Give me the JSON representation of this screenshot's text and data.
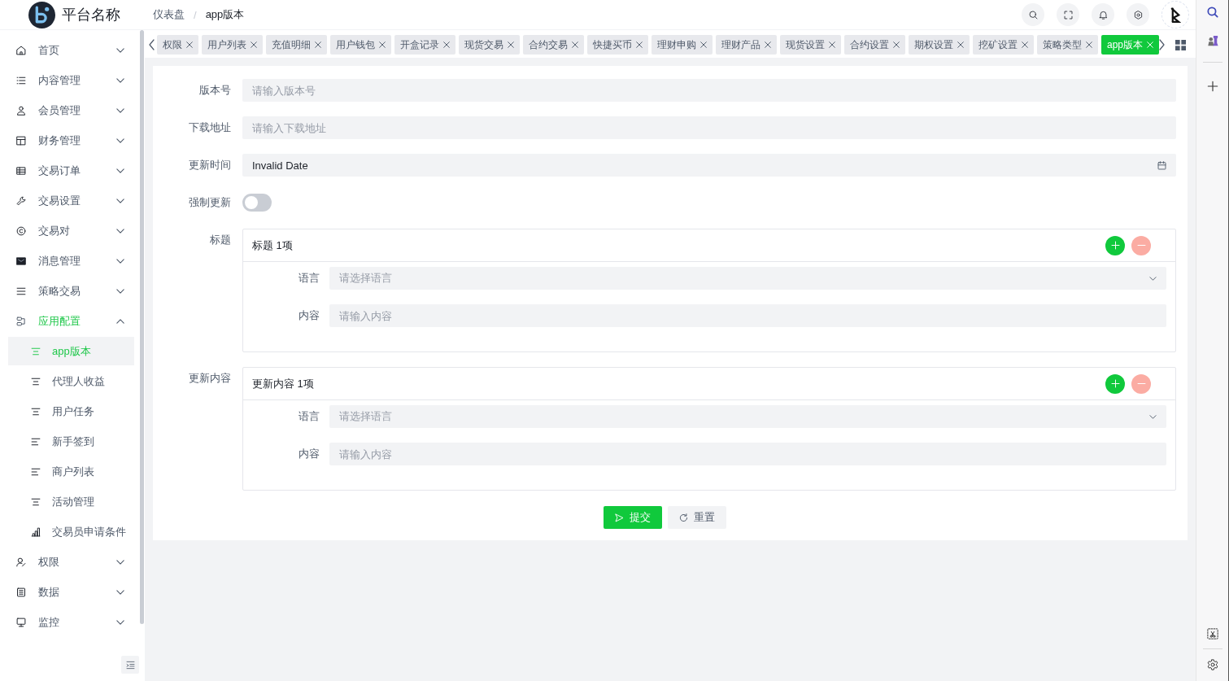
{
  "header": {
    "brand": "平台名称",
    "breadcrumb": {
      "items": [
        "仪表盘",
        "app版本"
      ],
      "separator": "/"
    }
  },
  "sidebar": {
    "items": [
      {
        "label": "首页",
        "expanded": false
      },
      {
        "label": "内容管理",
        "expanded": false
      },
      {
        "label": "会员管理",
        "expanded": false
      },
      {
        "label": "财务管理",
        "expanded": false
      },
      {
        "label": "交易订单",
        "expanded": false
      },
      {
        "label": "交易设置",
        "expanded": false
      },
      {
        "label": "交易对",
        "expanded": false
      },
      {
        "label": "消息管理",
        "expanded": false
      },
      {
        "label": "策略交易",
        "expanded": false
      },
      {
        "label": "应用配置",
        "expanded": true,
        "children": [
          {
            "label": "app版本",
            "selected": true
          },
          {
            "label": "代理人收益",
            "selected": false
          },
          {
            "label": "用户任务",
            "selected": false
          },
          {
            "label": "新手签到",
            "selected": false
          },
          {
            "label": "商户列表",
            "selected": false
          },
          {
            "label": "活动管理",
            "selected": false
          },
          {
            "label": "交易员申请条件",
            "selected": false
          }
        ]
      },
      {
        "label": "权限",
        "expanded": false
      },
      {
        "label": "数据",
        "expanded": false
      },
      {
        "label": "监控",
        "expanded": false
      }
    ]
  },
  "tabs": [
    {
      "label": "权限",
      "selected": false
    },
    {
      "label": "用户列表",
      "selected": false
    },
    {
      "label": "充值明细",
      "selected": false
    },
    {
      "label": "用户钱包",
      "selected": false
    },
    {
      "label": "开盒记录",
      "selected": false
    },
    {
      "label": "现货交易",
      "selected": false
    },
    {
      "label": "合约交易",
      "selected": false
    },
    {
      "label": "快捷买币",
      "selected": false
    },
    {
      "label": "理财申购",
      "selected": false
    },
    {
      "label": "理财产品",
      "selected": false
    },
    {
      "label": "现货设置",
      "selected": false
    },
    {
      "label": "合约设置",
      "selected": false
    },
    {
      "label": "期权设置",
      "selected": false
    },
    {
      "label": "挖矿设置",
      "selected": false
    },
    {
      "label": "策略类型",
      "selected": false
    },
    {
      "label": "app版本",
      "selected": true
    }
  ],
  "form": {
    "fields": [
      {
        "kind": "input",
        "label": "版本号",
        "placeholder": "请输入版本号"
      },
      {
        "kind": "input",
        "label": "下载地址",
        "placeholder": "请输入下载地址"
      },
      {
        "kind": "date",
        "label": "更新时间",
        "value": "Invalid Date"
      },
      {
        "kind": "switch",
        "label": "强制更新",
        "on": false
      },
      {
        "kind": "group",
        "label": "标题",
        "header": "标题 1项",
        "remove_disabled": true,
        "fields": [
          {
            "kind": "select",
            "label": "语言",
            "placeholder": "请选择语言"
          },
          {
            "kind": "input",
            "label": "内容",
            "placeholder": "请输入内容"
          }
        ]
      },
      {
        "kind": "group",
        "label": "更新内容",
        "header": "更新内容 1项",
        "remove_disabled": true,
        "fields": [
          {
            "kind": "select",
            "label": "语言",
            "placeholder": "请选择语言"
          },
          {
            "kind": "input",
            "label": "内容",
            "placeholder": "请输入内容"
          }
        ]
      }
    ],
    "buttons": [
      {
        "kind": "primary",
        "label": "提交"
      },
      {
        "kind": "secondary",
        "label": "重置"
      }
    ]
  }
}
